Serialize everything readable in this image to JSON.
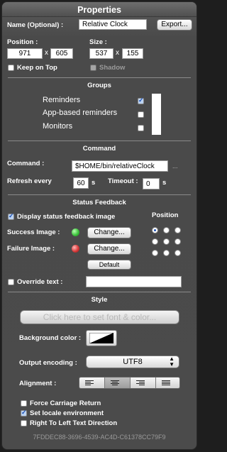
{
  "title": "Properties",
  "name": {
    "label": "Name (Optional) :",
    "value": "Relative Clock",
    "export_label": "Export..."
  },
  "position": {
    "label": "Position :",
    "x": "971",
    "sep": "x",
    "y": "605"
  },
  "size": {
    "label": "Size :",
    "w": "537",
    "sep": "x",
    "h": "155"
  },
  "keep_on_top": {
    "label": "Keep on Top",
    "checked": false
  },
  "shadow": {
    "label": "Shadow",
    "checked": false
  },
  "groups": {
    "title": "Groups",
    "items": [
      {
        "label": "Reminders",
        "checked": true
      },
      {
        "label": "App-based reminders",
        "checked": false
      },
      {
        "label": "Monitors",
        "checked": false
      }
    ]
  },
  "command": {
    "title": "Command",
    "label": "Command :",
    "value": "$HOME/bin/relativeClock",
    "ellipsis": "...",
    "refresh_label": "Refresh every",
    "refresh_value": "60",
    "refresh_unit": "s",
    "timeout_label": "Timeout :",
    "timeout_value": "0",
    "timeout_unit": "s"
  },
  "status": {
    "title": "Status Feedback",
    "display_label": "Display status feedback image",
    "display_checked": true,
    "position_label": "Position",
    "success_label": "Success Image :",
    "failure_label": "Failure Image :",
    "change_label": "Change...",
    "default_label": "Default",
    "success_color": "#3ec43e",
    "failure_color": "#d83a3a",
    "override_label": "Override text :",
    "override_value": ""
  },
  "style": {
    "title": "Style",
    "font_button": "Click here to set font & color...",
    "bg_label": "Background color :",
    "output_label": "Output encoding :",
    "output_value": "UTF8",
    "alignment_label": "Alignment :",
    "force_cr": "Force Carriage Return",
    "set_locale": "Set locale environment",
    "rtl": "Right To Left Text Direction",
    "force_cr_checked": false,
    "set_locale_checked": true,
    "rtl_checked": false
  },
  "uuid": "7FDDEC88-3696-4539-AC4D-C61378CC79F9"
}
